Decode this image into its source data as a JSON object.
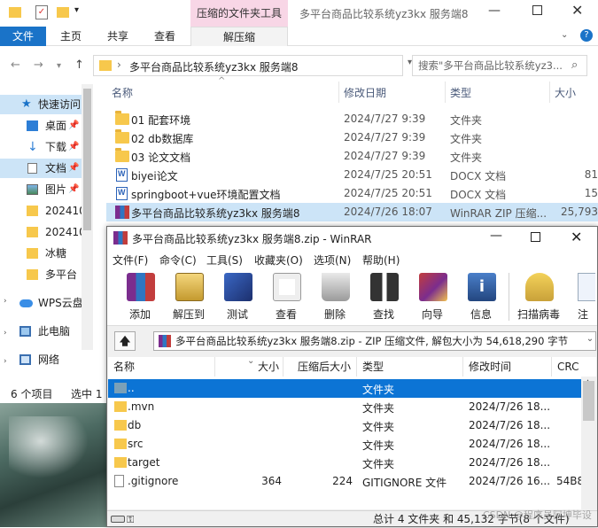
{
  "explorer": {
    "window_title": "多平台商品比较系统yz3kx 服务端8",
    "context_tab": "压缩的文件夹工具",
    "context_subtab": "解压缩",
    "ribbon_tabs": [
      "文件",
      "主页",
      "共享",
      "查看"
    ],
    "address_path": "多平台商品比较系统yz3kx 服务端8",
    "search_placeholder": "搜索\"多平台商品比较系统yz3...",
    "columns": {
      "name": "名称",
      "date": "修改日期",
      "type": "类型",
      "size": "大小"
    },
    "files": [
      {
        "name": "01 配套环境",
        "date": "2024/7/27 9:39",
        "type": "文件夹",
        "size": "",
        "icon": "folder-icon"
      },
      {
        "name": "02 db数据库",
        "date": "2024/7/27 9:39",
        "type": "文件夹",
        "size": "",
        "icon": "folder-icon"
      },
      {
        "name": "03 论文文档",
        "date": "2024/7/27 9:39",
        "type": "文件夹",
        "size": "",
        "icon": "folder-icon"
      },
      {
        "name": "biyei论文",
        "date": "2024/7/25 20:51",
        "type": "DOCX 文档",
        "size": "81",
        "icon": "word-doc-icon"
      },
      {
        "name": "springboot+vue环境配置文档",
        "date": "2024/7/25 20:51",
        "type": "DOCX 文档",
        "size": "15",
        "icon": "word-doc-icon"
      },
      {
        "name": "多平台商品比较系统yz3kx 服务端8",
        "date": "2024/7/26 18:07",
        "type": "WinRAR ZIP 压缩...",
        "size": "25,793",
        "icon": "winrar-archive-icon"
      }
    ],
    "sidebar": [
      {
        "label": "快速访问",
        "icon": "star-icon"
      },
      {
        "label": "桌面",
        "icon": "desktop-icon"
      },
      {
        "label": "下载",
        "icon": "download-icon"
      },
      {
        "label": "文档",
        "icon": "document-icon"
      },
      {
        "label": "图片",
        "icon": "picture-icon"
      },
      {
        "label": "202410",
        "icon": "folder-icon"
      },
      {
        "label": "202410",
        "icon": "folder-icon"
      },
      {
        "label": "冰糖",
        "icon": "folder-icon"
      },
      {
        "label": "多平台",
        "icon": "folder-icon"
      },
      {
        "label": "WPS云盘",
        "icon": "cloud-icon"
      },
      {
        "label": "此电脑",
        "icon": "computer-icon"
      },
      {
        "label": "网络",
        "icon": "network-icon"
      }
    ],
    "status_items": "6 个项目",
    "status_selected": "选中 1"
  },
  "winrar": {
    "title": "多平台商品比较系统yz3kx 服务端8.zip - WinRAR",
    "menu": [
      "文件(F)",
      "命令(C)",
      "工具(S)",
      "收藏夹(O)",
      "选项(N)",
      "帮助(H)"
    ],
    "toolbar": [
      "添加",
      "解压到",
      "测试",
      "查看",
      "删除",
      "查找",
      "向导",
      "信息",
      "扫描病毒",
      "注"
    ],
    "path_text": "多平台商品比较系统yz3kx 服务端8.zip - ZIP 压缩文件, 解包大小为 54,618,290 字节",
    "columns": {
      "name": "名称",
      "size": "大小",
      "packed": "压缩后大小",
      "type": "类型",
      "modified": "修改时间",
      "crc": "CRC"
    },
    "rows": [
      {
        "name": "..",
        "size": "",
        "packed": "",
        "type": "文件夹",
        "modified": "",
        "crc": ""
      },
      {
        "name": ".mvn",
        "size": "",
        "packed": "",
        "type": "文件夹",
        "modified": "2024/7/26 18...",
        "crc": ""
      },
      {
        "name": "db",
        "size": "",
        "packed": "",
        "type": "文件夹",
        "modified": "2024/7/26 18...",
        "crc": ""
      },
      {
        "name": "src",
        "size": "",
        "packed": "",
        "type": "文件夹",
        "modified": "2024/7/26 18...",
        "crc": ""
      },
      {
        "name": "target",
        "size": "",
        "packed": "",
        "type": "文件夹",
        "modified": "2024/7/26 18...",
        "crc": ""
      },
      {
        "name": ".gitignore",
        "size": "364",
        "packed": "224",
        "type": "GITIGNORE 文件",
        "modified": "2024/7/26 16...",
        "crc": "54B8"
      }
    ],
    "status_text": "总计 4 文件夹 和 45,132 字节(8 个文件)",
    "watermark": "CSDN @程序员阿坤毕设",
    "colors": {
      "selection": "#0c74d5",
      "accent": "#1a73c8"
    }
  }
}
